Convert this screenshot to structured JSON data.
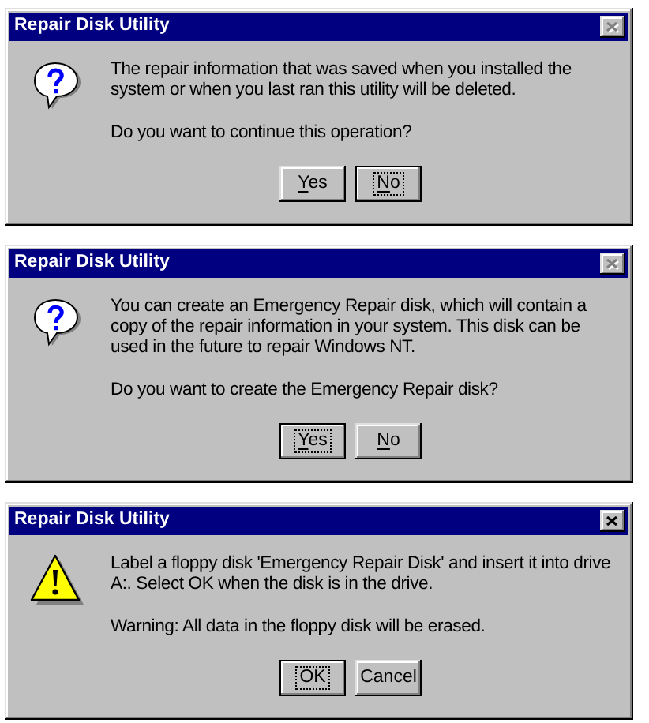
{
  "dialogs": [
    {
      "title": "Repair Disk Utility",
      "close_disabled": true,
      "kind": "question",
      "paragraphs": [
        "The repair information that was saved when you installed the system or when you last ran this utility will be deleted.",
        "Do you want to continue this operation?"
      ],
      "buttons": [
        {
          "label": "Yes",
          "mnemonic": true,
          "selected": false
        },
        {
          "label": "No",
          "mnemonic": true,
          "selected": true
        }
      ]
    },
    {
      "title": "Repair Disk Utility",
      "close_disabled": true,
      "kind": "question",
      "paragraphs": [
        "You can create an Emergency Repair disk, which will contain a copy of the repair information in your system. This disk can be used in the future to repair Windows NT.",
        "Do you want to create the Emergency Repair disk?"
      ],
      "buttons": [
        {
          "label": "Yes",
          "mnemonic": true,
          "selected": true
        },
        {
          "label": "No",
          "mnemonic": true,
          "selected": false
        }
      ]
    },
    {
      "title": "Repair Disk Utility",
      "close_disabled": false,
      "kind": "warning",
      "paragraphs": [
        "Label a floppy disk 'Emergency Repair Disk' and insert it into drive A:. Select OK when the disk is in the drive.",
        "Warning: All data in the floppy disk will be erased."
      ],
      "buttons": [
        {
          "label": "OK",
          "mnemonic": false,
          "selected": true
        },
        {
          "label": "Cancel",
          "mnemonic": false,
          "selected": false
        }
      ]
    }
  ]
}
